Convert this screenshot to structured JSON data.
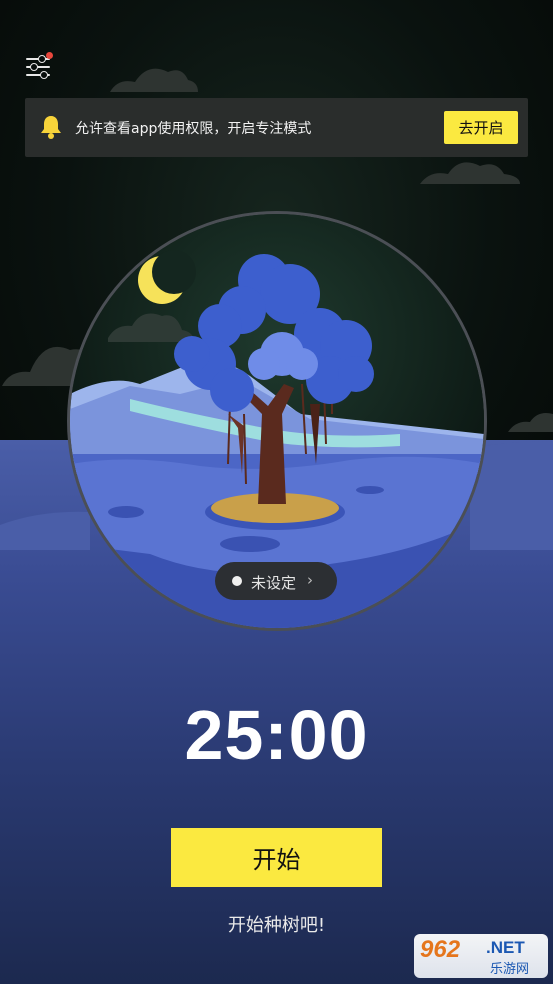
{
  "banner": {
    "text": "允许查看app使用权限，开启专注模式",
    "button_label": "去开启"
  },
  "status": {
    "label": "未设定",
    "chevron": "›"
  },
  "timer": {
    "value": "25:00"
  },
  "actions": {
    "start_label": "开始",
    "hint": "开始种树吧!"
  },
  "watermark": {
    "number": "962",
    "suffix": ".NET",
    "site": "乐游网"
  },
  "colors": {
    "accent_yellow": "#fbe940",
    "background": "#070d0b",
    "sea": "#3a4c93",
    "notification_dot": "#e8473c"
  },
  "icons": [
    "menu-settings-icon",
    "bell-icon",
    "moon-icon",
    "chevron-right-icon"
  ]
}
